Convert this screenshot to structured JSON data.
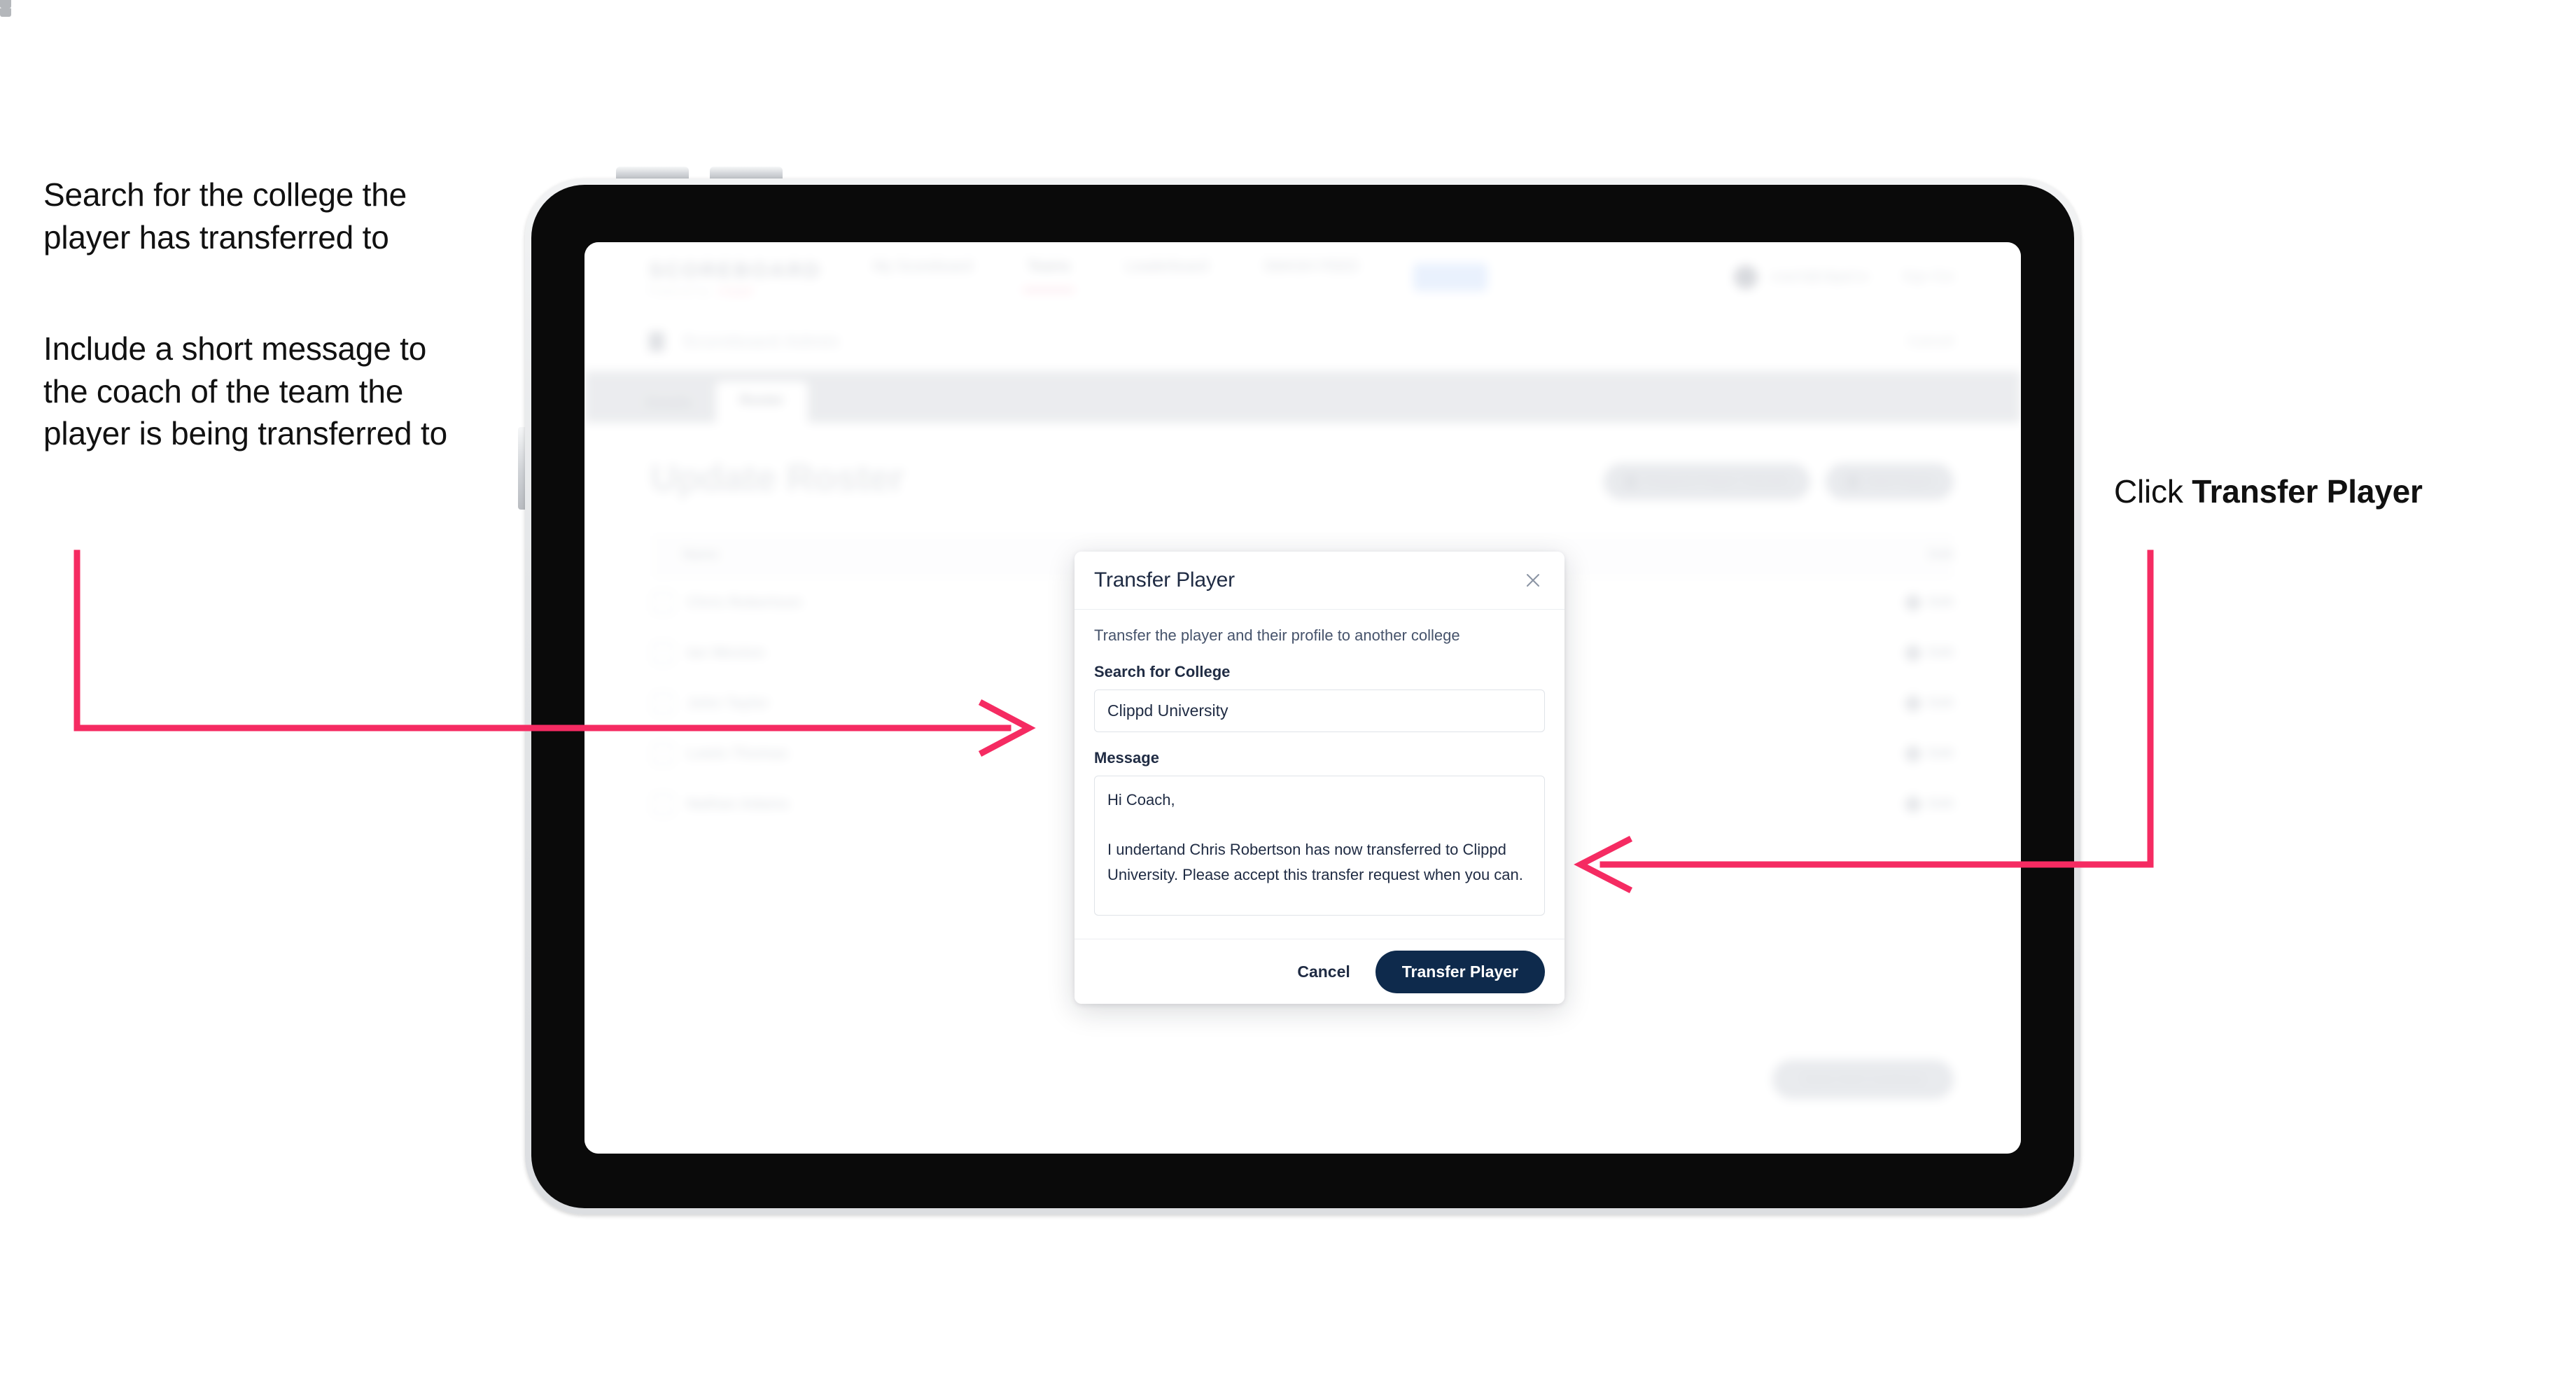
{
  "annotations": {
    "left_top": "Search for the college the player has transferred to",
    "left_bottom": "Include a short message to the coach of the team the player is being transferred to",
    "right_prefix": "Click ",
    "right_bold": "Transfer Player"
  },
  "colors": {
    "arrow_pink": "#F52B62",
    "primary_navy": "#0E2A4C",
    "modal_text": "#1F2B43",
    "modal_subtext": "#46536B",
    "input_border": "#DFE3E8",
    "tab_strip": "#D3D6DB"
  },
  "modal": {
    "title": "Transfer Player",
    "close_icon": "close-icon",
    "subtitle": "Transfer the player and their profile to another college",
    "college_label": "Search for College",
    "college_value": "Clippd University",
    "college_placeholder": "Search for College",
    "message_label": "Message",
    "message_value": "Hi Coach,\n\nI undertand Chris Robertson has now transferred to Clippd University. Please accept this transfer request when you can.",
    "message_placeholder": "Message",
    "cancel_label": "Cancel",
    "submit_label": "Transfer Player"
  },
  "app": {
    "brand": "SCOREBOARD",
    "brand_sub_a": "Powered by",
    "brand_sub_b": "clippd",
    "nav": [
      {
        "label": "My Scoreboard",
        "active": false
      },
      {
        "label": "Teams",
        "active": true
      },
      {
        "label": "Leaderboard",
        "active": false
      },
      {
        "label": "SMASH FEED",
        "active": false
      }
    ],
    "nav_pill": "Admin",
    "user_email": "coach@clippd.io",
    "sign_out": "Sign Out",
    "breadcrumb": "Scoreboard",
    "breadcrumb_sub": "Admin",
    "breadcrumb_right": "Cancel",
    "tabs": [
      {
        "label": "Details",
        "selected": false
      },
      {
        "label": "Roster",
        "selected": true
      }
    ],
    "page_title": "Update Roster",
    "header_buttons": [
      "Request Player Transfer",
      "Add Player"
    ],
    "table": {
      "columns": [
        "",
        "Name",
        "Edit"
      ],
      "rows": [
        {
          "name": "Chris Robertson",
          "action": "Edit"
        },
        {
          "name": "Ian Weston",
          "action": "Edit"
        },
        {
          "name": "John Taylor",
          "action": "Edit"
        },
        {
          "name": "Lewis Thomas",
          "action": "Edit"
        },
        {
          "name": "Nathan Adams",
          "action": "Edit"
        }
      ]
    },
    "bottom_button": "Save And Continue"
  }
}
